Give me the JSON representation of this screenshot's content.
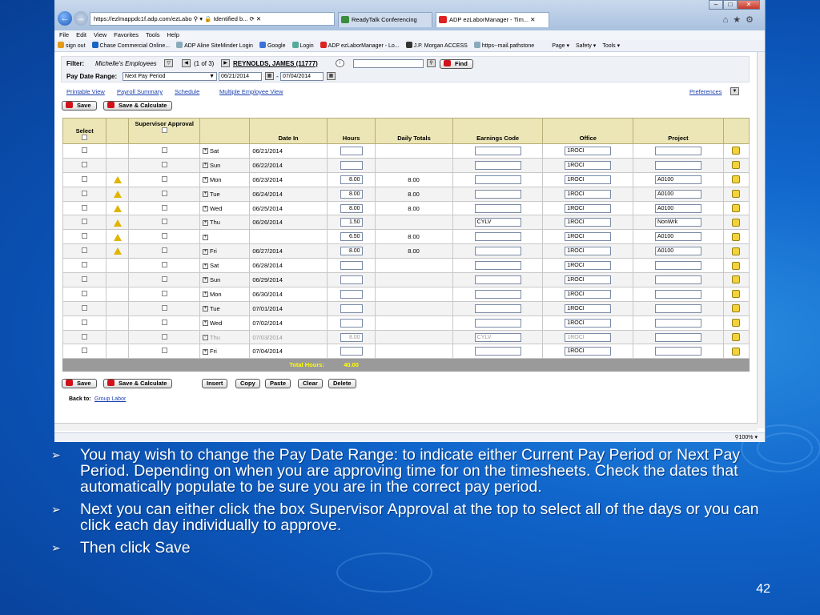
{
  "browser": {
    "address": "https://ezlmappdc1f.adp.com/ezLabo",
    "identified": "Identified b...",
    "tabs": [
      "ReadyTalk Conferencing",
      "ADP ezLaborManager - Tim..."
    ],
    "menu": [
      "File",
      "Edit",
      "View",
      "Favorites",
      "Tools",
      "Help"
    ],
    "favorites": [
      "sign out",
      "Chase Commercial Online...",
      "ADP Aline SiteMinder Login",
      "Google",
      "Login",
      "ADP ezLaborManager - Lo...",
      "J.P. Morgan ACCESS",
      "https--mail.pathstone",
      "Page ▾",
      "Safety ▾",
      "Tools ▾"
    ],
    "zoom": "100%"
  },
  "filter": {
    "label": "Filter:",
    "value": "Michelle's Employees",
    "count": "(1 of 3)",
    "employee": "REYNOLDS, JAMES (11777)",
    "find": "Find",
    "pay_date_label": "Pay Date Range:",
    "pay_date_value": "Next Pay Period",
    "date_from": "06/21/2014",
    "date_to": "07/04/2014",
    "dash": "-"
  },
  "links": [
    "Printable View",
    "Payroll Summary",
    "Schedule",
    "Multiple Employee View"
  ],
  "preferences": "Preferences",
  "buttons": {
    "save": "Save",
    "save_calc": "Save & Calculate",
    "insert": "Insert",
    "copy": "Copy",
    "paste": "Paste",
    "clear": "Clear",
    "delete": "Delete"
  },
  "table": {
    "headers": [
      "Select",
      "",
      "Supervisor Approval",
      "",
      "Date In",
      "Hours",
      "Daily Totals",
      "Earnings Code",
      "Office",
      "Project"
    ],
    "rows": [
      {
        "day": "Sat",
        "date": "06/21/2014",
        "hours": "",
        "daily": "",
        "code": "",
        "office": "1ROCI",
        "project": "",
        "warn": false
      },
      {
        "day": "Sun",
        "date": "06/22/2014",
        "hours": "",
        "daily": "",
        "code": "",
        "office": "1ROCI",
        "project": "",
        "warn": false
      },
      {
        "day": "Mon",
        "date": "06/23/2014",
        "hours": "8.00",
        "daily": "8.00",
        "code": "",
        "office": "1ROCI",
        "project": "A0100",
        "warn": true
      },
      {
        "day": "Tue",
        "date": "06/24/2014",
        "hours": "8.00",
        "daily": "8.00",
        "code": "",
        "office": "1ROCI",
        "project": "A0100",
        "warn": true
      },
      {
        "day": "Wed",
        "date": "06/25/2014",
        "hours": "8.00",
        "daily": "8.00",
        "code": "",
        "office": "1ROCI",
        "project": "A0100",
        "warn": true
      },
      {
        "day": "Thu",
        "date": "06/26/2014",
        "hours": "1.50",
        "daily": "",
        "code": "CYLV",
        "office": "1ROCI",
        "project": "NonWrk",
        "warn": true
      },
      {
        "day": "",
        "date": "",
        "hours": "6.50",
        "daily": "8.00",
        "code": "",
        "office": "1ROCI",
        "project": "A0100",
        "warn": true
      },
      {
        "day": "Fri",
        "date": "06/27/2014",
        "hours": "8.00",
        "daily": "8.00",
        "code": "",
        "office": "1ROCI",
        "project": "A0100",
        "warn": true
      },
      {
        "day": "Sat",
        "date": "06/28/2014",
        "hours": "",
        "daily": "",
        "code": "",
        "office": "1ROCI",
        "project": "",
        "warn": false
      },
      {
        "day": "Sun",
        "date": "06/29/2014",
        "hours": "",
        "daily": "",
        "code": "",
        "office": "1ROCI",
        "project": "",
        "warn": false
      },
      {
        "day": "Mon",
        "date": "06/30/2014",
        "hours": "",
        "daily": "",
        "code": "",
        "office": "1ROCI",
        "project": "",
        "warn": false
      },
      {
        "day": "Tue",
        "date": "07/01/2014",
        "hours": "",
        "daily": "",
        "code": "",
        "office": "1ROCI",
        "project": "",
        "warn": false
      },
      {
        "day": "Wed",
        "date": "07/02/2014",
        "hours": "",
        "daily": "",
        "code": "",
        "office": "1ROCI",
        "project": "",
        "warn": false
      },
      {
        "day": "Thu",
        "date": "07/03/2014",
        "hours": "8.00",
        "daily": "",
        "code": "CYLV",
        "office": "1ROCI",
        "project": "",
        "warn": false,
        "gray": true
      },
      {
        "day": "Fri",
        "date": "07/04/2014",
        "hours": "",
        "daily": "",
        "code": "",
        "office": "1ROCI",
        "project": "",
        "warn": false
      }
    ],
    "total_label": "Total Hours:",
    "total_value": "40.00"
  },
  "back": {
    "label": "Back to:",
    "link": "Group Labor"
  },
  "bullets": [
    "You may wish to change the Pay Date Range: to indicate either Current Pay Period or Next Pay Period. Depending on when you are approving time for on the timesheets. Check the dates that automatically populate to be sure you are in the correct pay period.",
    "Next you can either click the box Supervisor Approval at the top to select all of the days or you can click each day individually to approve.",
    "Then click Save"
  ],
  "page_number": "42"
}
